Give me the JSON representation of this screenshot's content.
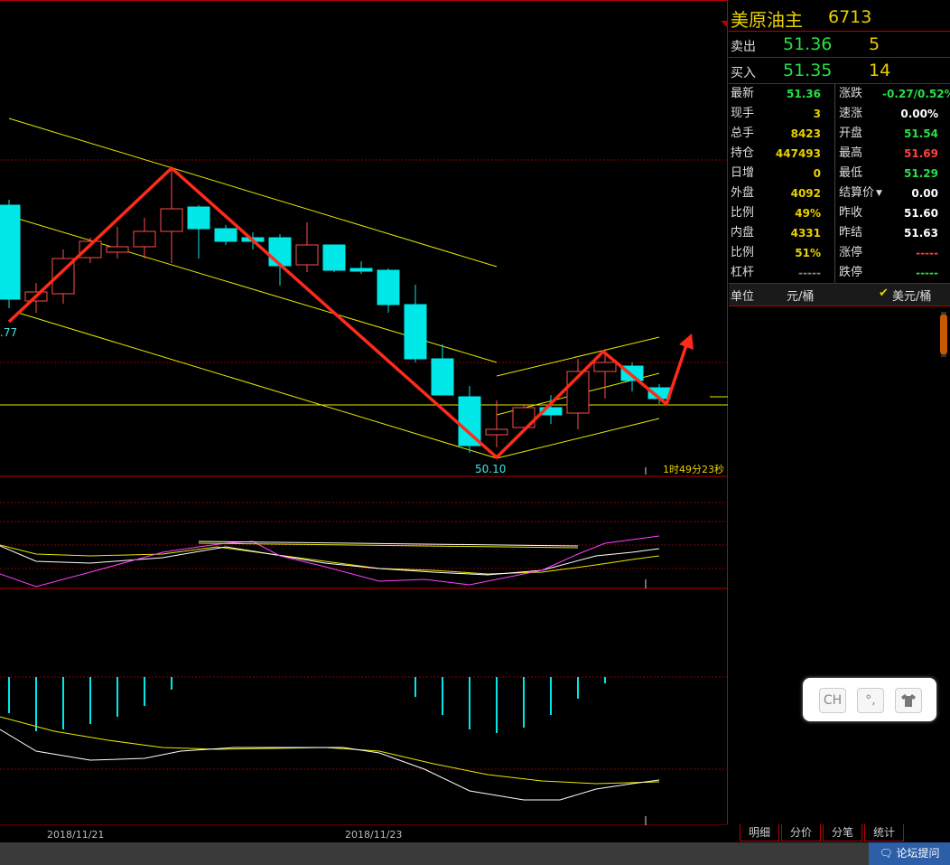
{
  "chart_data": {
    "type": "candlestick",
    "xlabels": [
      "2018/11/21",
      "2018/11/23"
    ],
    "annotations": {
      "high_left": ".77",
      "low": "50.10",
      "countdown": "1时49分23秒"
    }
  },
  "quote": {
    "name": "美原油主",
    "code": "6713",
    "sell_label": "卖出",
    "sell_price": "51.36",
    "sell_vol": "5",
    "buy_label": "买入",
    "buy_price": "51.35",
    "buy_vol": "14",
    "left": [
      {
        "label": "最新",
        "value": "51.36",
        "color": "#27e047"
      },
      {
        "label": "现手",
        "value": "3",
        "color": "#e8d000"
      },
      {
        "label": "总手",
        "value": "8423",
        "color": "#e8d000"
      },
      {
        "label": "持仓",
        "value": "447493",
        "color": "#e8d000"
      },
      {
        "label": "日增",
        "value": "0",
        "color": "#e8d000"
      },
      {
        "label": "外盘",
        "value": "4092",
        "color": "#e8d000"
      },
      {
        "label": "比例",
        "value": "49%",
        "color": "#e8d000"
      },
      {
        "label": "内盘",
        "value": "4331",
        "color": "#e8d000"
      },
      {
        "label": "比例",
        "value": "51%",
        "color": "#e8d000"
      },
      {
        "label": "杠杆",
        "value": "-----",
        "color": "#888"
      }
    ],
    "right": [
      {
        "label": "涨跌",
        "value": "-0.27/0.52%",
        "color": "#27e047"
      },
      {
        "label": "速涨",
        "value": "0.00%",
        "color": "#fff"
      },
      {
        "label": "开盘",
        "value": "51.54",
        "color": "#27e047"
      },
      {
        "label": "最高",
        "value": "51.69",
        "color": "#ff4040"
      },
      {
        "label": "最低",
        "value": "51.29",
        "color": "#27e047"
      },
      {
        "label": "结算价",
        "value": "0.00",
        "color": "#fff"
      },
      {
        "label": "昨收",
        "value": "51.60",
        "color": "#fff"
      },
      {
        "label": "昨结",
        "value": "51.63",
        "color": "#fff"
      },
      {
        "label": "涨停",
        "value": "-----",
        "color": "#ff4040"
      },
      {
        "label": "跌停",
        "value": "-----",
        "color": "#27e047"
      }
    ],
    "unit_label": "单位",
    "unit_opt1": "元/桶",
    "unit_opt2": "美元/桶"
  },
  "toolbar": {
    "ch": "CH",
    "punct": "°,",
    "shirt": "shirt-icon"
  },
  "tabs": [
    "明细",
    "分价",
    "分笔",
    "统计"
  ],
  "footer": {
    "forum_button": "论坛提问"
  }
}
